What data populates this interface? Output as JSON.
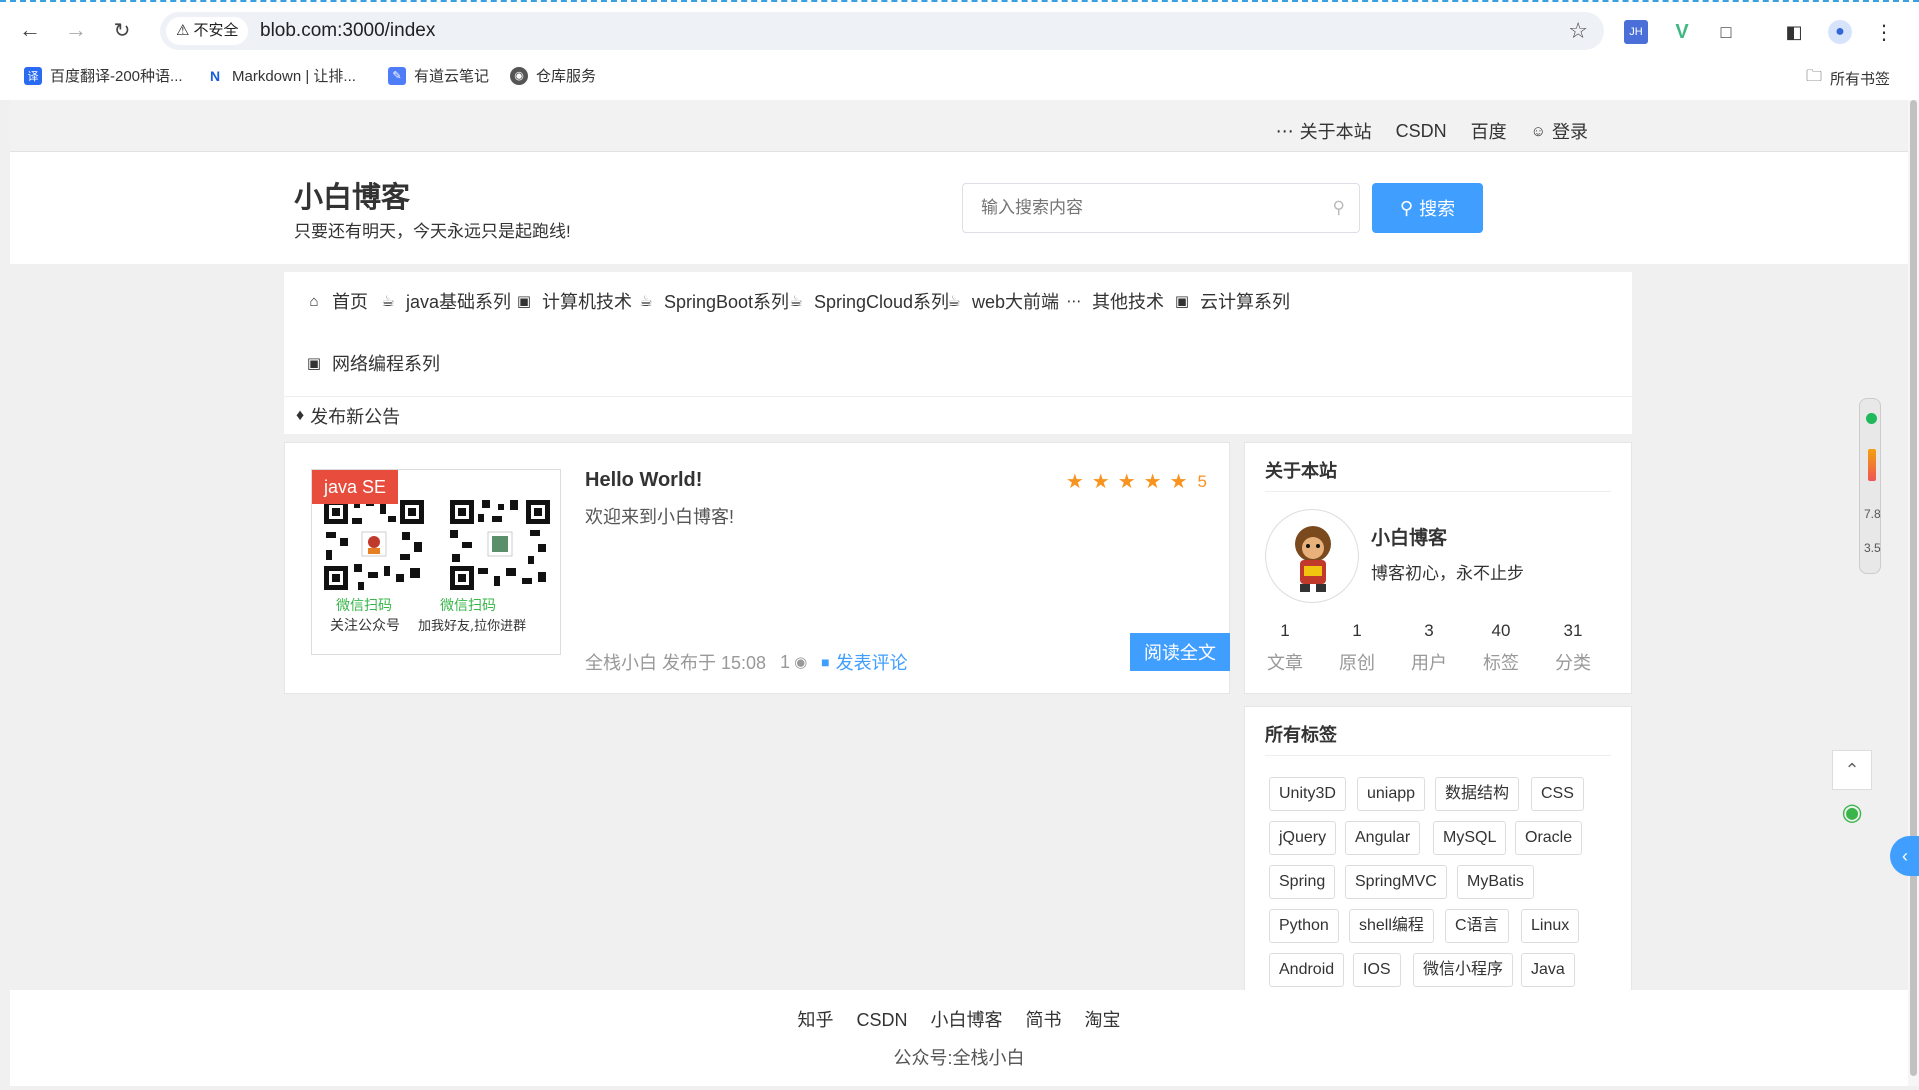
{
  "browser": {
    "security_label": "不安全",
    "url": "blob.com:3000/index",
    "bookmarks": [
      {
        "label": "百度翻译-200种语...",
        "icon": "translate-icon"
      },
      {
        "label": "Markdown | 让排...",
        "icon": "markdown-icon"
      },
      {
        "label": "有道云笔记",
        "icon": "note-icon"
      },
      {
        "label": "仓库服务",
        "icon": "globe-icon"
      }
    ],
    "all_bookmarks": "所有书签",
    "ext_jh": "JH"
  },
  "topbar": {
    "about": "关于本站",
    "csdn": "CSDN",
    "baidu": "百度",
    "login": "登录"
  },
  "header": {
    "title": "小白博客",
    "subtitle": "只要还有明天，今天永远只是起跑线!",
    "search_placeholder": "输入搜索内容",
    "search_button": "搜索"
  },
  "nav": {
    "items": [
      {
        "label": "首页",
        "icon": "home-icon"
      },
      {
        "label": "java基础系列",
        "icon": "cup-icon"
      },
      {
        "label": "计算机技术",
        "icon": "monitor-icon"
      },
      {
        "label": "SpringBoot系列",
        "icon": "cup-icon"
      },
      {
        "label": "SpringCloud系列",
        "icon": "cup-icon"
      },
      {
        "label": "web大前端",
        "icon": "cup-icon"
      },
      {
        "label": "其他技术",
        "icon": "more-icon"
      },
      {
        "label": "云计算系列",
        "icon": "monitor-icon"
      },
      {
        "label": "网络编程系列",
        "icon": "monitor-icon"
      }
    ],
    "notice": "发布新公告"
  },
  "article": {
    "category": "java SE",
    "qr_left_caption1": "微信扫码",
    "qr_left_caption2": "关注公众号",
    "qr_right_caption1": "微信扫码",
    "qr_right_caption2": "加我好友,拉你进群",
    "title": "Hello World!",
    "description": "欢迎来到小白博客!",
    "rating": 5,
    "rating_label": "5",
    "author_time": "全栈小白 发布于 15:08",
    "views": "1",
    "comment_label": "发表评论",
    "read_more": "阅读全文"
  },
  "about": {
    "heading": "关于本站",
    "name": "小白博客",
    "motto": "博客初心，永不止步",
    "stats": [
      {
        "num": "1",
        "label": "文章"
      },
      {
        "num": "1",
        "label": "原创"
      },
      {
        "num": "3",
        "label": "用户"
      },
      {
        "num": "40",
        "label": "标签"
      },
      {
        "num": "31",
        "label": "分类"
      }
    ]
  },
  "tags": {
    "heading": "所有标签",
    "items": [
      "Unity3D",
      "uniapp",
      "数据结构",
      "CSS",
      "jQuery",
      "Angular",
      "MySQL",
      "Oracle",
      "Spring",
      "SpringMVC",
      "MyBatis",
      "Python",
      "shell编程",
      "C语言",
      "Linux",
      "Android",
      "IOS",
      "微信小程序",
      "Java"
    ]
  },
  "footer": {
    "links": [
      "知乎",
      "CSDN",
      "小白博客",
      "简书",
      "淘宝"
    ],
    "copyright": "公众号:全栈小白"
  },
  "speed": {
    "up": "7.8",
    "down": "3.5",
    "unit": "K/s"
  },
  "colors": {
    "accent": "#409eff",
    "tag_red": "#e74c3c",
    "star": "#f7931e",
    "wechat_green": "#39b54a"
  }
}
